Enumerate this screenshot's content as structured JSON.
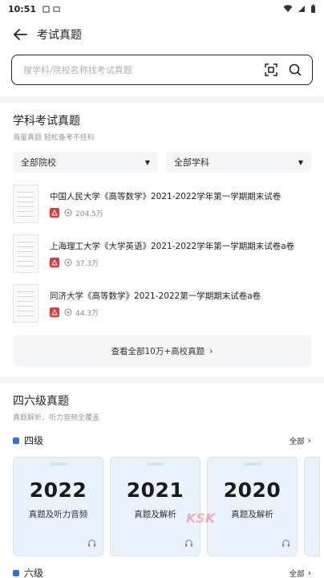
{
  "status": {
    "time": "10:51"
  },
  "header": {
    "title": "考试真题"
  },
  "search": {
    "placeholder": "搜学科/院校名称找考试真题"
  },
  "subject_section": {
    "title": "学科考试真题",
    "subtitle": "海量真题 轻松备考不挂科",
    "filters": [
      "全部院校",
      "全部学科"
    ],
    "papers": [
      {
        "title": "中国人民大学《高等数学》2021-2022学年第一学期期末试卷",
        "views": "204.5万"
      },
      {
        "title": "上海理工大学《大学英语》2021-2022学年第一学期期末试卷a卷",
        "views": "37.3万"
      },
      {
        "title": "同济大学《高等数学》2021-2022第一学期期末试卷a卷",
        "views": "44.3万"
      }
    ],
    "view_all": "查看全部10万+高校真题"
  },
  "cet_section": {
    "title": "四六级真题",
    "subtitle": "真题解析，听力音频全覆盖",
    "level4": {
      "name": "四级",
      "more": "全部"
    },
    "cards": [
      {
        "year": "2022",
        "label": "真题及听力音频"
      },
      {
        "year": "2021",
        "label": "真题及解析"
      },
      {
        "year": "2020",
        "label": "真题及解析"
      }
    ],
    "level6": {
      "name": "六级",
      "more": "全部"
    }
  },
  "watermark": "KSK",
  "colors": {
    "accent": "#2f6fe4",
    "pdf_red": "#e53935",
    "card_bg": "#eaf2fd"
  }
}
